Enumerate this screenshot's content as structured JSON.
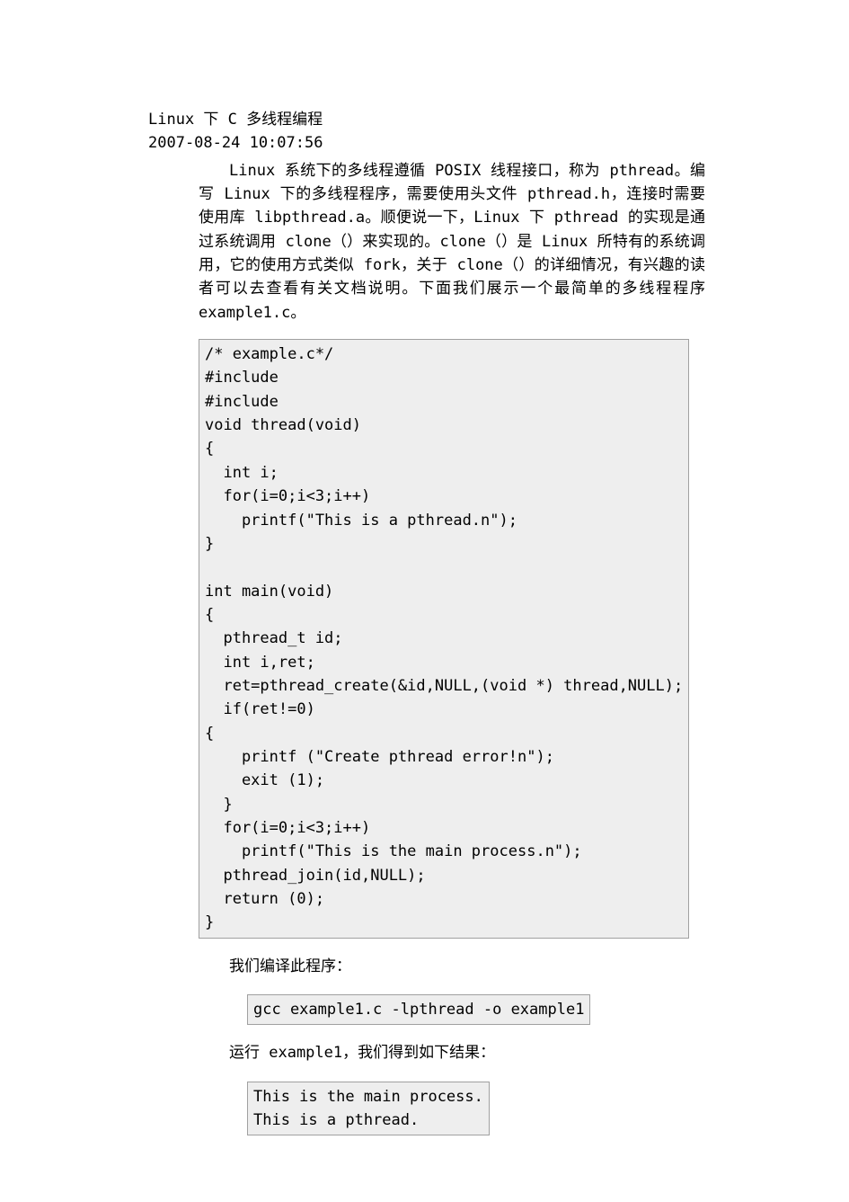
{
  "header": {
    "title": "Linux 下 C 多线程编程",
    "timestamp": "2007-08-24 10:07:56"
  },
  "intro": "Linux 系统下的多线程遵循 POSIX 线程接口，称为 pthread。编写 Linux 下的多线程程序，需要使用头文件 pthread.h，连接时需要使用库 libpthread.a。顺便说一下，Linux 下 pthread 的实现是通过系统调用 clone（）来实现的。clone（）是 Linux 所特有的系统调用，它的使用方式类似 fork，关于 clone（）的详细情况，有兴趣的读者可以去查看有关文档说明。下面我们展示一个最简单的多线程程序 example1.c。",
  "code1": "/* example.c*/\n#include\n#include\nvoid thread(void)\n{\n  int i;\n  for(i=0;i<3;i++)\n    printf(\"This is a pthread.n\");\n}\n\nint main(void)\n{\n  pthread_t id;\n  int i,ret;\n  ret=pthread_create(&id,NULL,(void *) thread,NULL);\n  if(ret!=0)\n{\n    printf (\"Create pthread error!n\");\n    exit (1);\n  }\n  for(i=0;i<3;i++)\n    printf(\"This is the main process.n\");\n  pthread_join(id,NULL);\n  return (0);\n}",
  "para_compile": "我们编译此程序：",
  "cmd_compile": "gcc example1.c -lpthread -o example1",
  "para_run": "运行 example1，我们得到如下结果：",
  "output_run": "This is the main process.\nThis is a pthread."
}
